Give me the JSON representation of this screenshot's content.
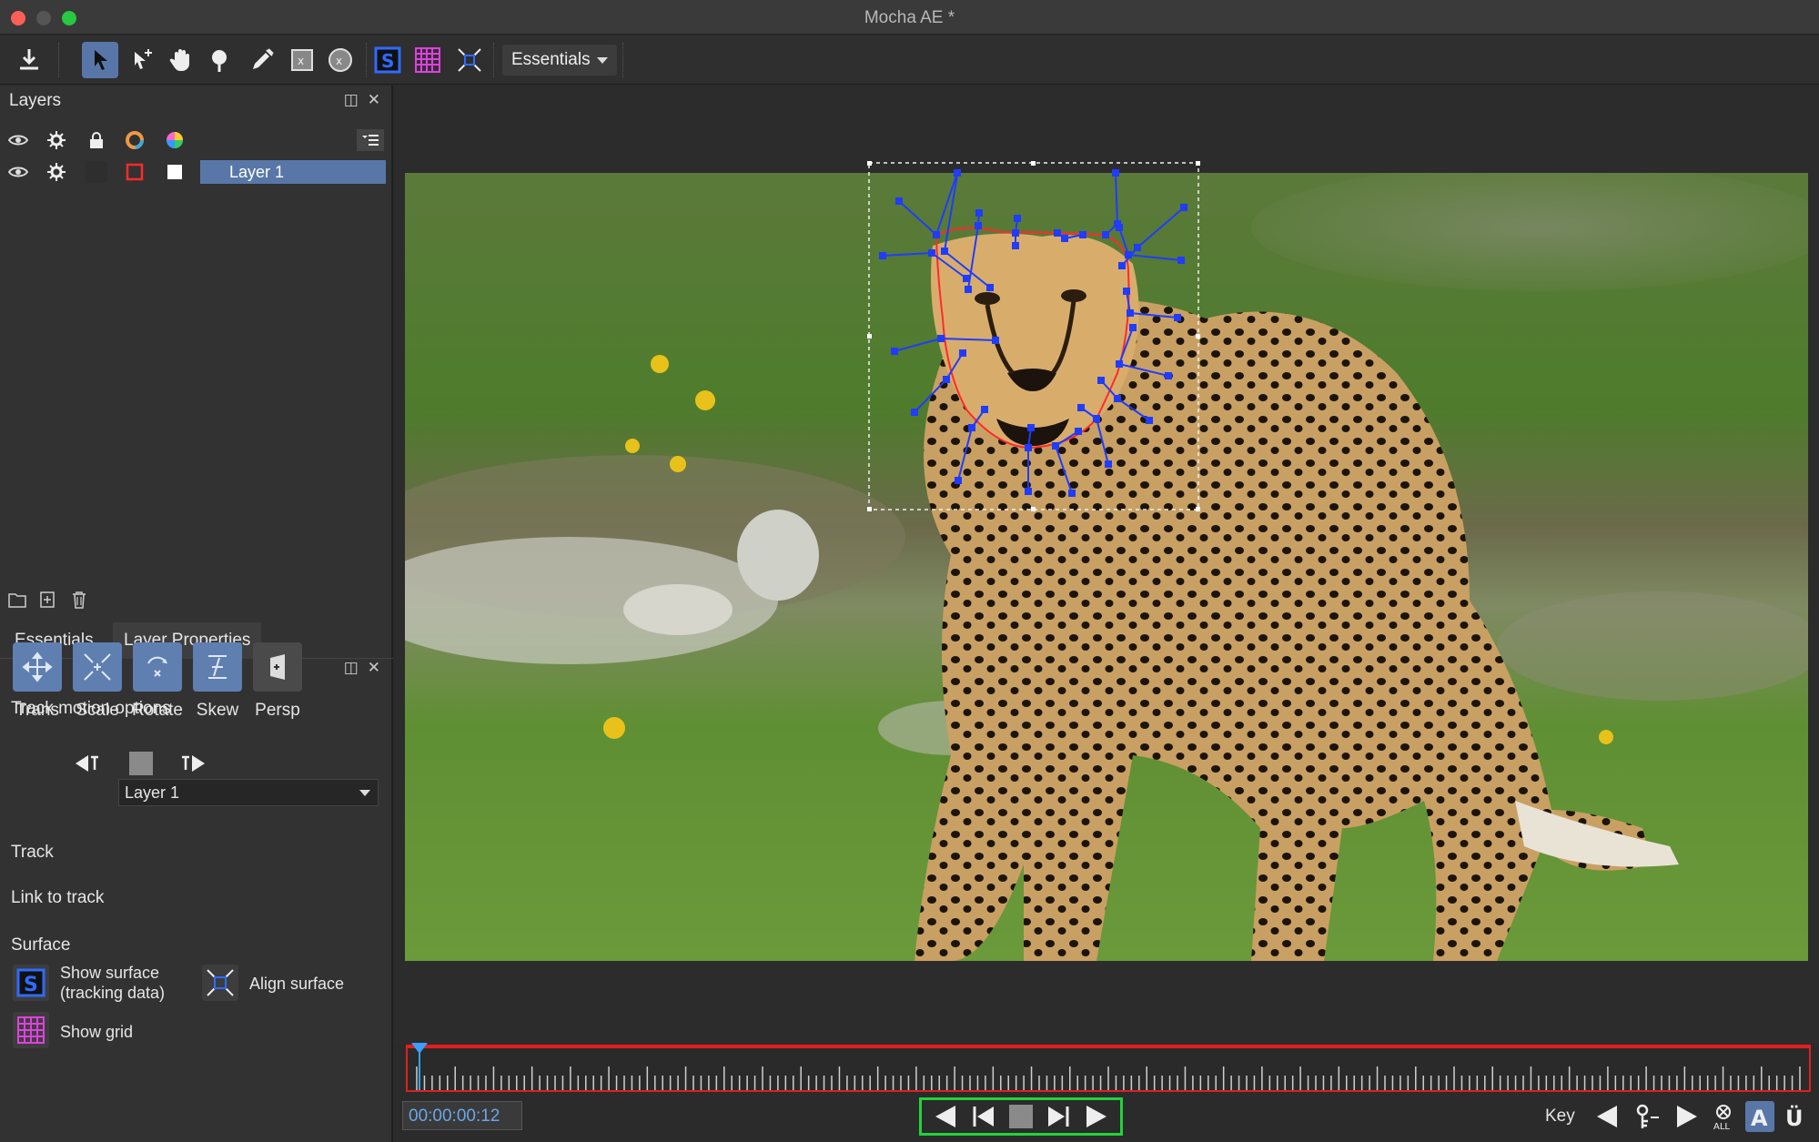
{
  "window": {
    "title": "Mocha AE *"
  },
  "toolbar": {
    "workspace_select": "Essentials"
  },
  "layers_panel": {
    "title": "Layers",
    "layers": [
      {
        "name": "Layer 1"
      }
    ]
  },
  "tabs": [
    {
      "label": "Essentials"
    },
    {
      "label": "Layer Properties"
    }
  ],
  "properties": {
    "track_motion_title": "Track motion options",
    "motion_options": [
      {
        "label": "Trans",
        "enabled": true
      },
      {
        "label": "Scale",
        "enabled": true
      },
      {
        "label": "Rotate",
        "enabled": true
      },
      {
        "label": "Skew",
        "enabled": true
      },
      {
        "label": "Persp",
        "enabled": false
      }
    ],
    "track_label": "Track",
    "link_to_track_label": "Link to track",
    "link_to_track_value": "Layer 1",
    "surface_title": "Surface",
    "show_surface_label_1": "Show surface",
    "show_surface_label_2": "(tracking data)",
    "align_surface_label": "Align surface",
    "show_grid_label": "Show grid"
  },
  "timeline": {
    "timecode": "00:00:00:12",
    "key_label": "Key"
  },
  "colors": {
    "accent_blue": "#5877a8",
    "timeline_red": "#e02020",
    "transport_green": "#22d33a",
    "spline_blue": "#1f3cff",
    "spline_red": "#ff2a2a"
  }
}
